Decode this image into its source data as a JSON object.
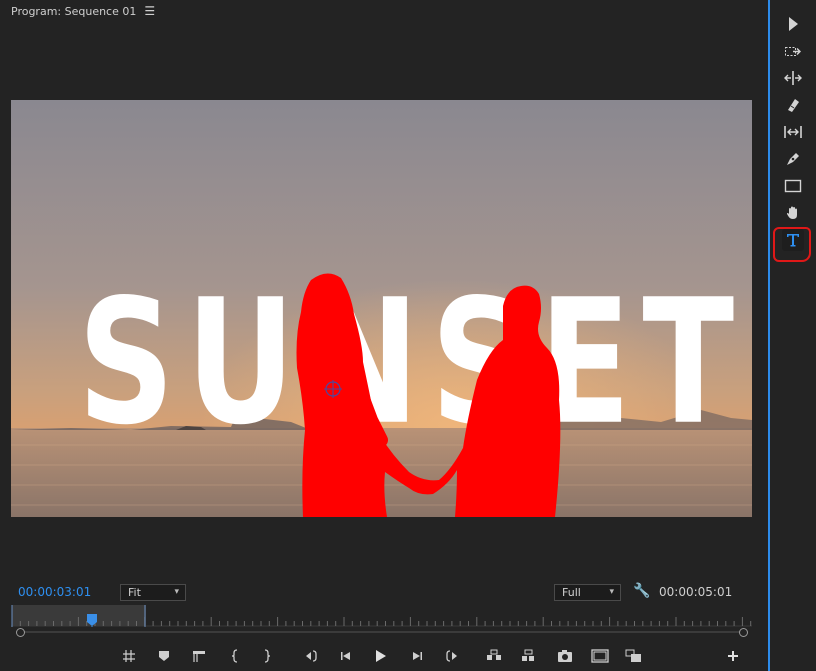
{
  "panel": {
    "title": "Program: Sequence 01",
    "menu_icon": "hamburger-icon"
  },
  "video": {
    "title_text": "SUNSET",
    "title_color": "#ffffff",
    "mask_color": "#ff0000",
    "sky_top": "#8d8b90",
    "sky_horizon": "#c89a78",
    "sea": "#a98c7a"
  },
  "controls": {
    "current_timecode": "00:00:03:01",
    "duration_timecode": "00:00:05:01",
    "zoom_level": "Fit",
    "resolution": "Full",
    "accent_color": "#2e8ff0"
  },
  "transport_buttons": [
    "add-marker",
    "marker",
    "mark-in",
    "mark-out",
    "mark-in-brace",
    "mark-out-brace",
    "go-to-in",
    "step-back",
    "play",
    "step-forward",
    "go-to-out",
    "lift",
    "extract",
    "export-frame",
    "comparison-view",
    "toggle-proxies",
    "button-editor"
  ],
  "tools": [
    "selection-tool",
    "track-select-forward-tool",
    "ripple-edit-tool",
    "razor-tool",
    "slip-tool",
    "pen-tool",
    "rectangle-tool",
    "hand-tool",
    "type-tool"
  ],
  "selected_tool": "type-tool",
  "annotation_color": "#e01818"
}
